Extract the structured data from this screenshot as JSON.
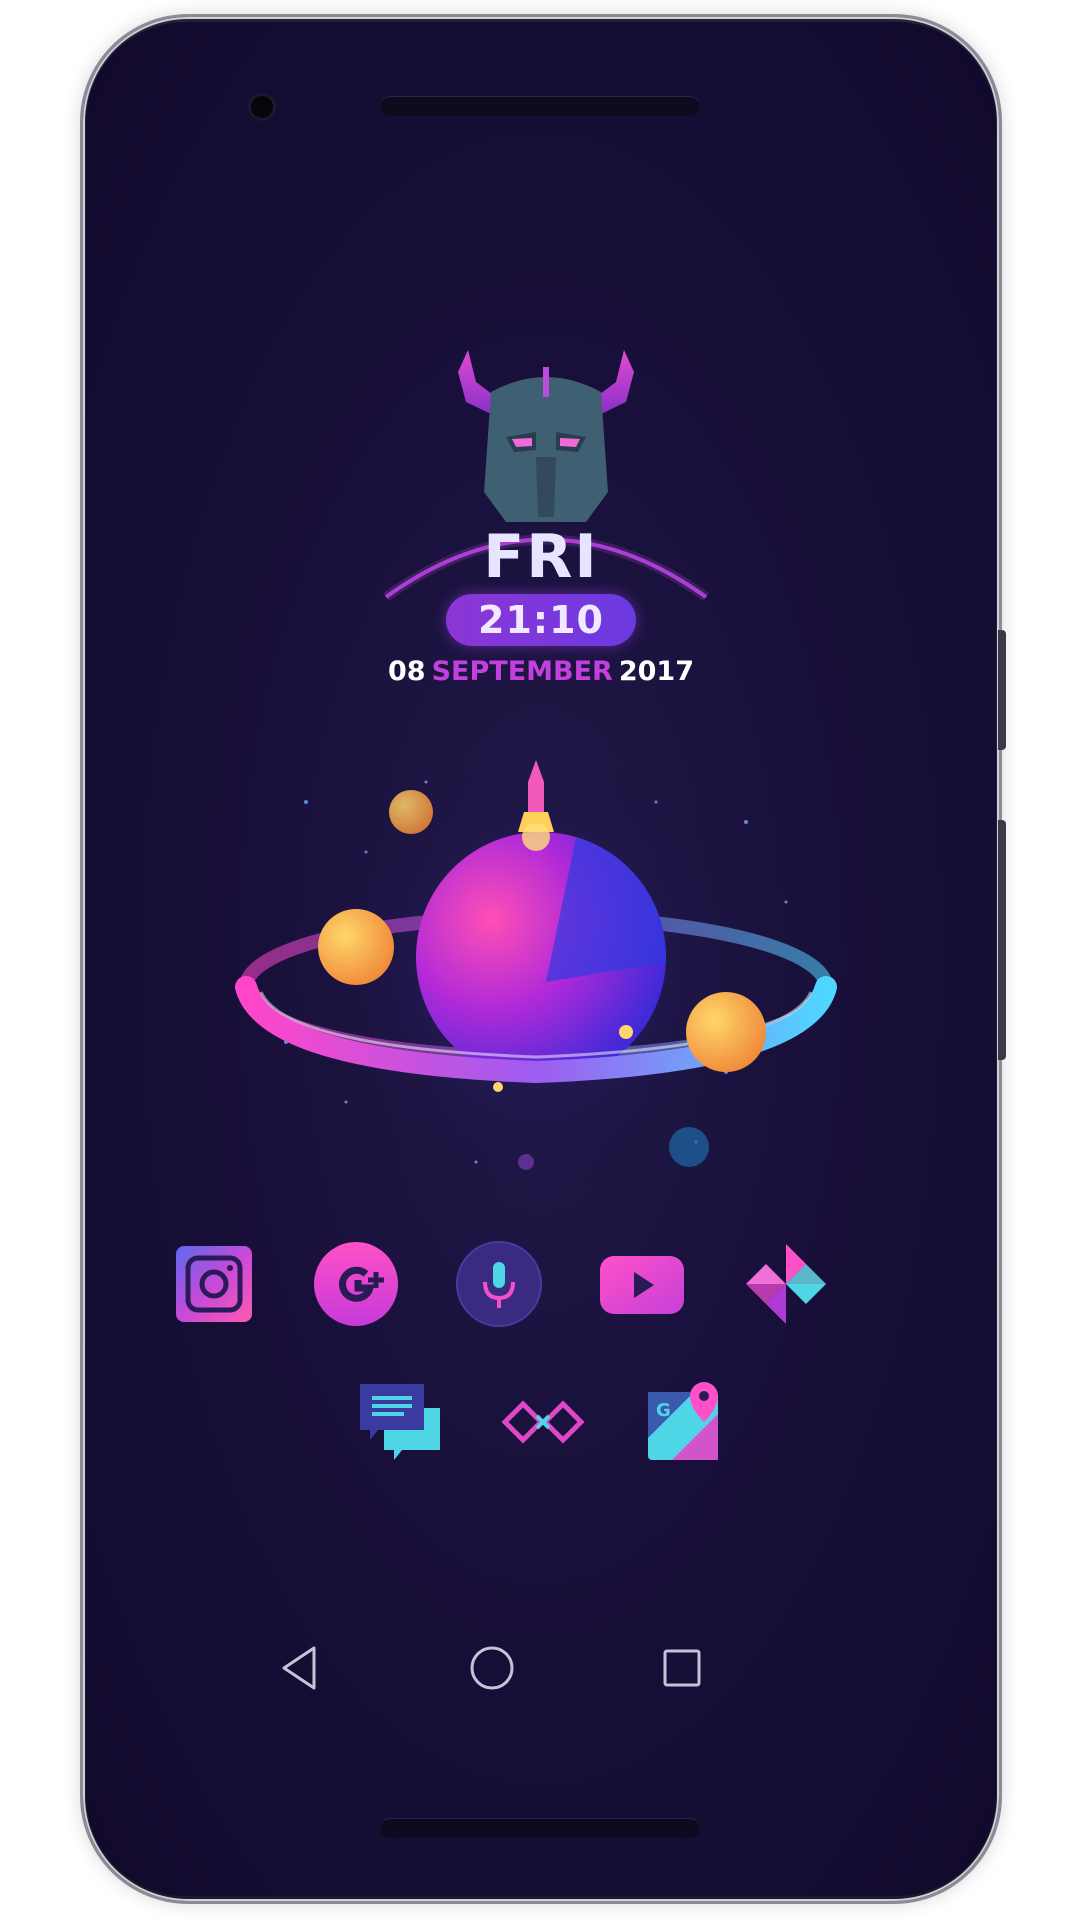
{
  "clock_widget": {
    "day": "FRI",
    "time": "21:10",
    "date_day": "08",
    "date_month": "SEPTEMBER",
    "date_year": "2017"
  },
  "home_icons": [
    {
      "name": "instagram-icon"
    },
    {
      "name": "google-plus-icon"
    },
    {
      "name": "voice-search-icon"
    },
    {
      "name": "youtube-icon"
    },
    {
      "name": "google-photos-icon"
    },
    {
      "name": "messages-icon"
    },
    {
      "name": "link-app-icon"
    },
    {
      "name": "google-maps-icon"
    }
  ],
  "navigation_bar": {
    "back": "back-icon",
    "home": "home-icon",
    "recents": "recents-icon"
  },
  "colors": {
    "background": "#140c30",
    "accent_pink": "#e046c8",
    "accent_purple": "#7c3ae0",
    "accent_cyan": "#4fd6e6",
    "frame": "#232336"
  }
}
